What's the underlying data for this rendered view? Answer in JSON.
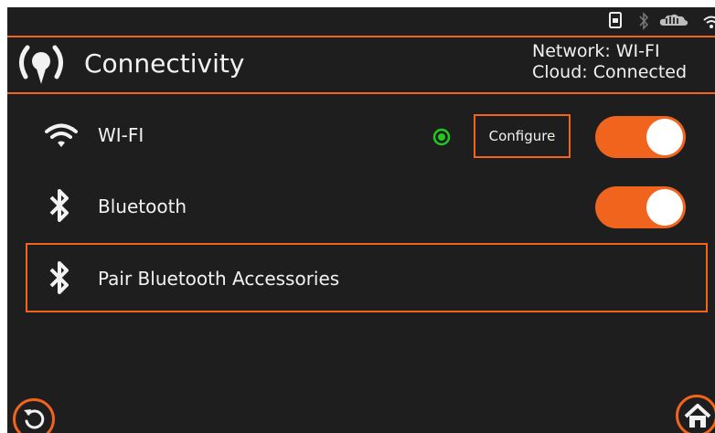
{
  "header": {
    "title": "Connectivity",
    "network_status": "Network: WI-FI",
    "cloud_status": "Cloud: Connected"
  },
  "wifi": {
    "label": "WI-FI",
    "configure_label": "Configure",
    "enabled": true,
    "connected_indicator": "green"
  },
  "bluetooth": {
    "label": "Bluetooth",
    "enabled": true
  },
  "pair": {
    "label": "Pair Bluetooth Accessories"
  },
  "icons": {
    "status_bar": [
      "device-icon",
      "bluetooth-icon",
      "cloud-icon",
      "wifi-icon"
    ],
    "header": "connectivity-signal-icon",
    "back": "back-arrow-icon",
    "home": "home-icon"
  },
  "colors": {
    "accent": "#f0641e",
    "background": "#1e1e1e",
    "text": "#f2f2f2",
    "indicator": "#22c81e"
  }
}
